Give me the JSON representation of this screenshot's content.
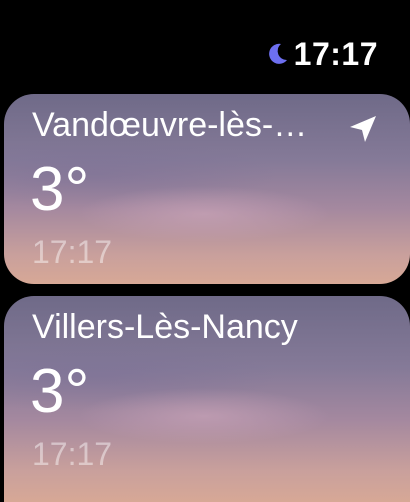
{
  "status": {
    "time": "17:17",
    "mode_icon": "moon-icon",
    "mode_color": "#6d6ff0"
  },
  "locations": [
    {
      "city": "Vandœuvre-lès-…",
      "temperature": "3°",
      "time": "17:17",
      "current_location_icon": "location-arrow-icon"
    },
    {
      "city": "Villers-Lès-Nancy",
      "temperature": "3°",
      "time": "17:17"
    }
  ]
}
